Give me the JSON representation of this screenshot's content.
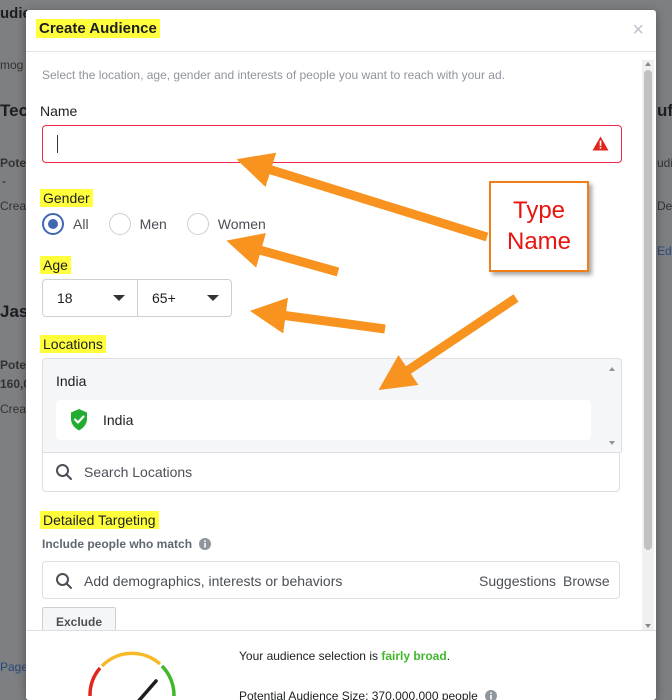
{
  "background": {
    "fragments": [
      "udie",
      "mog",
      "Tec",
      "Pote",
      "-",
      "Crea",
      "Jas",
      "Pote",
      "160,0",
      "Crea",
      "Page",
      "uf",
      "udi",
      "Dec",
      "Ed"
    ]
  },
  "modal": {
    "title": "Create Audience",
    "close_icon": "close-icon",
    "subtitle": "Select the location, age, gender and interests of people you want to reach with your ad."
  },
  "name_field": {
    "label": "Name",
    "value": "",
    "warning_icon": "warning-triangle-icon",
    "error_color": "#f02849"
  },
  "gender": {
    "label": "Gender",
    "options": [
      {
        "label": "All",
        "selected": true
      },
      {
        "label": "Men",
        "selected": false
      },
      {
        "label": "Women",
        "selected": false
      }
    ]
  },
  "age": {
    "label": "Age",
    "min": "18",
    "max": "65+"
  },
  "locations": {
    "label": "Locations",
    "country": "India",
    "selected": "India",
    "selected_icon": "location-check-icon",
    "search_placeholder": "Search Locations"
  },
  "detailed_targeting": {
    "label": "Detailed Targeting",
    "include_label": "Include people who match",
    "search_placeholder": "Add demographics, interests or behaviors",
    "suggestions": "Suggestions",
    "browse": "Browse",
    "exclude": "Exclude"
  },
  "audience": {
    "breadth_prefix": "Your audience selection is",
    "breadth_value": "fairly broad",
    "breadth_suffix": ".",
    "size_text": "Potential Audience Size: 370,000,000 people"
  },
  "annotation": {
    "line1": "Type",
    "line2": "Name",
    "arrow_color": "#f7931e",
    "text_color": "#e8150f"
  },
  "colors": {
    "highlight": "#ffff3c",
    "accent": "#4267b2",
    "success": "#42b72a"
  }
}
